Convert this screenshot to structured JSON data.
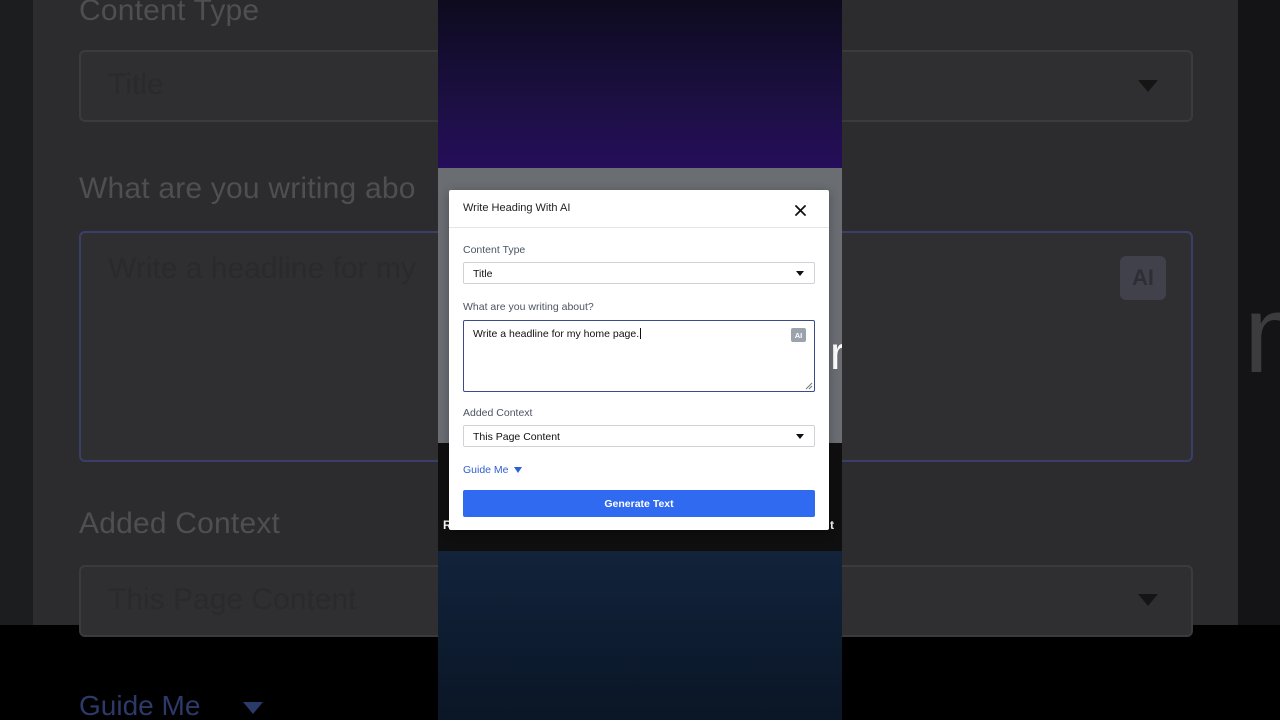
{
  "modal": {
    "title": "Write Heading With AI",
    "content_type_label": "Content Type",
    "content_type_value": "Title",
    "writing_label": "What are you writing about?",
    "writing_value": "Write a headline for my home page.",
    "ai_badge": "AI",
    "added_context_label": "Added Context",
    "added_context_value": "This Page Content",
    "guide_me": "Guide Me",
    "generate_button": "Generate Text"
  },
  "background": {
    "content_type_label": "Content Type",
    "content_type_value": "Title",
    "writing_label": "What are you writing abo",
    "writing_value": "Write a headline for my",
    "ai_badge": "AI",
    "added_context_label": "Added Context",
    "added_context_value": "This Page Content",
    "guide_me": "Guide Me"
  },
  "video": {
    "glyph_left": "r",
    "glyph_right": "m",
    "caption_left": "R",
    "caption_right": "t"
  },
  "colors": {
    "accent": "#2f6af0",
    "link": "#2f5fd0",
    "textarea_border": "#3a4a8a"
  }
}
